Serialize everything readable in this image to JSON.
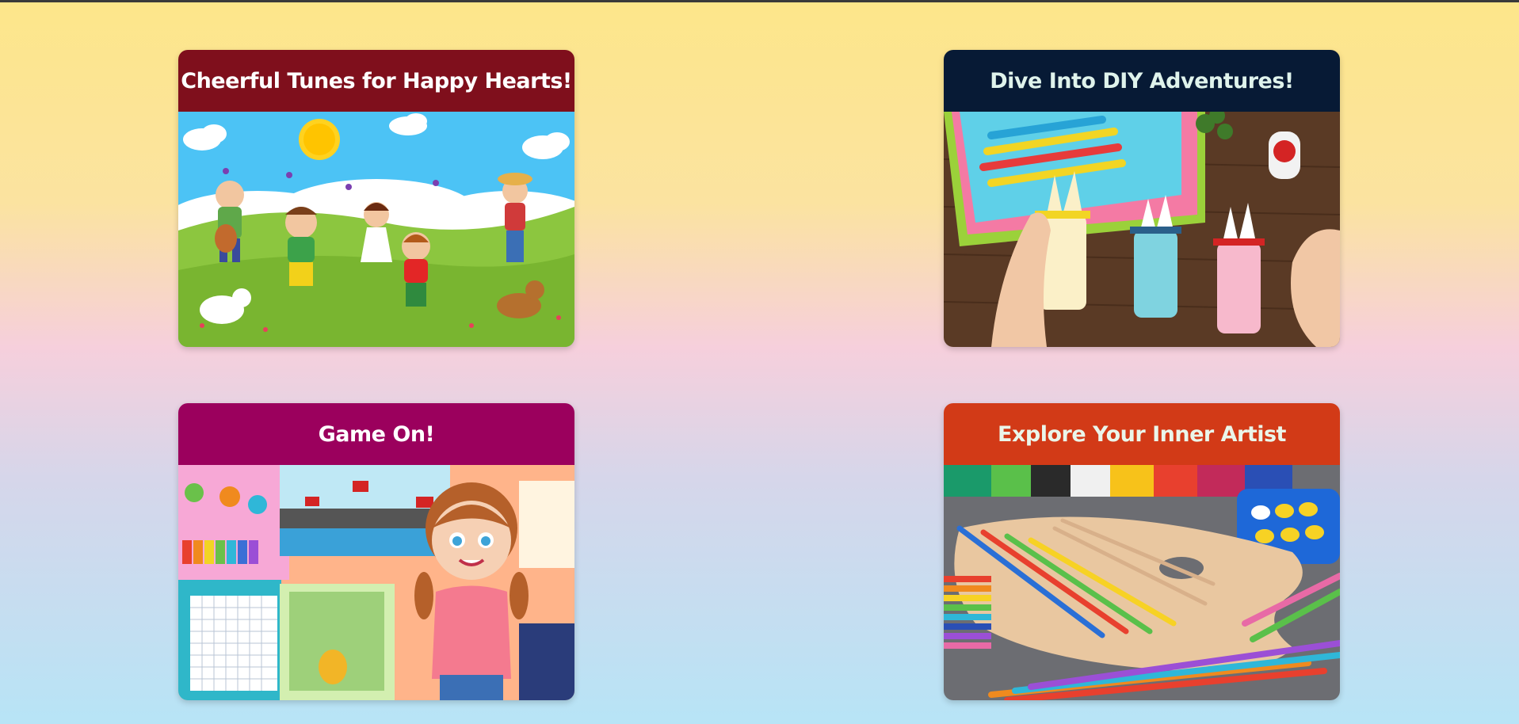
{
  "cards": [
    {
      "title": "Cheerful Tunes for Happy Hearts!",
      "header_bg": "#7f0f1c",
      "title_color": "#ffffff",
      "image": "kids-music-illustration"
    },
    {
      "title": "Dive Into DIY Adventures!",
      "header_bg": "#071a35",
      "title_color": "#dff3ec",
      "image": "popsicle-stick-bunny-crafts"
    },
    {
      "title": "Game On!",
      "header_bg": "#9b005d",
      "title_color": "#ffffff",
      "image": "kids-games-collage"
    },
    {
      "title": "Explore Your Inner Artist",
      "header_bg": "#d23a17",
      "title_color": "#eaf6ea",
      "image": "art-supplies-palette"
    }
  ]
}
